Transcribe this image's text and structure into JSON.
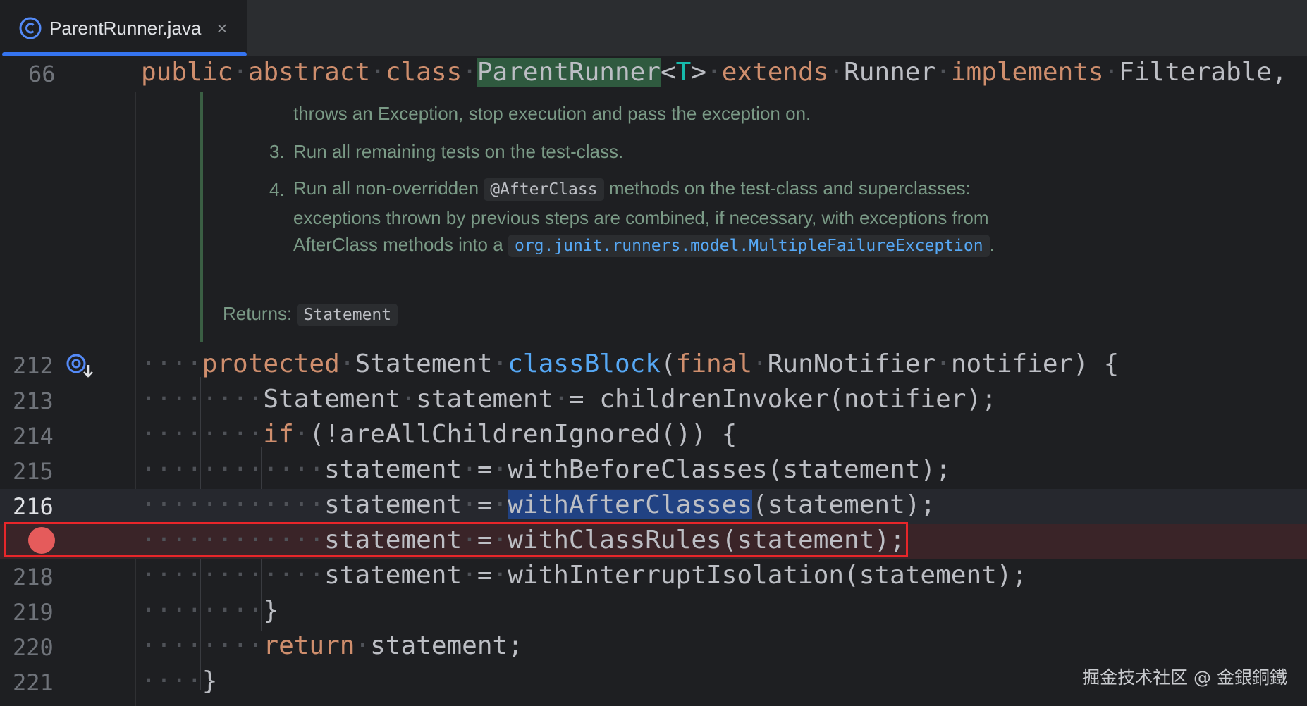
{
  "tab": {
    "title": "ParentRunner.java",
    "close": "×",
    "icon": "class-icon"
  },
  "sticky": {
    "line_number": "66",
    "tokens": [
      "public",
      "abstract",
      "class",
      "ParentRunner",
      "<",
      "T",
      ">",
      "extends",
      "Runner",
      "implements",
      "Filterable,"
    ]
  },
  "doc": {
    "line1": "throws an Exception, stop execution and pass the exception on.",
    "item3_num": "3.",
    "item3": "Run all remaining tests on the test-class.",
    "item4_num": "4.",
    "item4_a": "Run all non-overridden",
    "item4_code": "@AfterClass",
    "item4_b": "methods on the test-class and superclasses:",
    "item4_line2": "exceptions thrown by previous steps are combined, if necessary, with exceptions from",
    "item4_line3": "AfterClass methods into a",
    "item4_link": "org.junit.runners.model.MultipleFailureException",
    "item4_end": ".",
    "returns_label": "Returns:",
    "returns_type": "Statement"
  },
  "lines": {
    "l212": {
      "num": "212",
      "protected": "protected",
      "type": "Statement",
      "method": "classBlock",
      "open": "(",
      "final": "final",
      "param_type": "RunNotifier",
      "param": "notifier",
      "close": ") {"
    },
    "l213": {
      "num": "213",
      "text_a": "Statement",
      "text_b": "statement",
      "text_c": "= childrenInvoker(notifier);"
    },
    "l214": {
      "num": "214",
      "kw": "if",
      "rest": "(!areAllChildrenIgnored()) {"
    },
    "l215": {
      "num": "215",
      "lhs": "statement",
      "eq": "=",
      "rhs": "withBeforeClasses(statement);"
    },
    "l216": {
      "num": "216",
      "lhs": "statement",
      "eq": "=",
      "sel": "withAfterClasses",
      "rhs": "(statement);"
    },
    "l217": {
      "lhs": "statement",
      "eq": "=",
      "rhs": "withClassRules(statement);"
    },
    "l218": {
      "num": "218",
      "lhs": "statement",
      "eq": "=",
      "rhs": "withInterruptIsolation(statement);"
    },
    "l219": {
      "num": "219",
      "text": "}"
    },
    "l220": {
      "num": "220",
      "kw": "return",
      "rest": "statement;"
    },
    "l221": {
      "num": "221",
      "text": "}"
    }
  },
  "watermark": "掘金技术社区 @ 金銀銅鐵",
  "colors": {
    "background": "#1e1f22",
    "keyword": "#cf8e6d",
    "method": "#56a8f5",
    "type_param": "#16baac",
    "breakpoint": "#e55b5b",
    "highlight_box": "#e8262a",
    "tab_underline": "#3574f0"
  }
}
